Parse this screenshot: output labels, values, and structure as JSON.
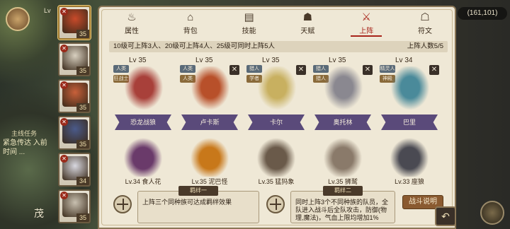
{
  "hud": {
    "level_prefix": "Lv",
    "gold": "(161,101)",
    "quest_title": "主线任务",
    "quest_text": "紧急传达 入前时间 ...",
    "player_name": "茂"
  },
  "hero_list": [
    {
      "level": "35",
      "selected": true
    },
    {
      "level": "35"
    },
    {
      "level": "35"
    },
    {
      "level": "35"
    },
    {
      "level": "34"
    },
    {
      "level": "35"
    }
  ],
  "tabs": [
    {
      "label": "属性",
      "icon": "flame-icon"
    },
    {
      "label": "背包",
      "icon": "backpack-icon"
    },
    {
      "label": "技能",
      "icon": "book-icon"
    },
    {
      "label": "天赋",
      "icon": "talent-icon"
    },
    {
      "label": "上阵",
      "icon": "crossed-swords-icon",
      "active": true
    },
    {
      "label": "符文",
      "icon": "rune-icon"
    }
  ],
  "formation": {
    "rule_text": "10级可上阵3人、20级可上阵4人、25级可同时上阵5人",
    "count_text": "上阵人数5/5"
  },
  "heroes": [
    {
      "level": "Lv 35",
      "tags": [
        "人类",
        "狂战士"
      ],
      "name": "恐龙战狼",
      "removable": false,
      "color": "#a8403a"
    },
    {
      "level": "Lv 35",
      "tags": [
        "人类",
        "人类"
      ],
      "name": "卢卡斯",
      "removable": true,
      "color": "#b8502a"
    },
    {
      "level": "Lv 35",
      "tags": [
        "猎人",
        "学者"
      ],
      "name": "卡尔",
      "removable": true,
      "color": "#c8b060"
    },
    {
      "level": "Lv 35",
      "tags": [
        "猎人",
        "猎人"
      ],
      "name": "奥托林",
      "removable": true,
      "color": "#8a8890"
    },
    {
      "level": "Lv 34",
      "tags": [
        "精灵人",
        "神殿"
      ],
      "name": "巴里",
      "removable": true,
      "color": "#4a8a9a"
    }
  ],
  "pets": [
    {
      "caption": "Lv.34 食人花",
      "color": "#6a3a6a"
    },
    {
      "caption": "Lv.35 泥巴怪",
      "color": "#c8781a"
    },
    {
      "caption": "Lv.35 猛犸象",
      "color": "#6a5a4a"
    },
    {
      "caption": "Lv.35 狮鹫",
      "color": "#8a7a6a"
    },
    {
      "caption": "Lv.33 座狼",
      "color": "#4a4a52"
    }
  ],
  "bonds": {
    "bond1_title": "羁绊一",
    "bond1_text": "上阵三个同种族可达成羁绊效果",
    "bond2_title": "羁绊二",
    "bond2_text": "同时上阵3个不同种族的队员，全队进入战斗后全队攻击，防御(物理,魔法)，气血上限均增加1%",
    "battle_label": "战斗说明"
  },
  "back_icon": "return-arrow-icon"
}
